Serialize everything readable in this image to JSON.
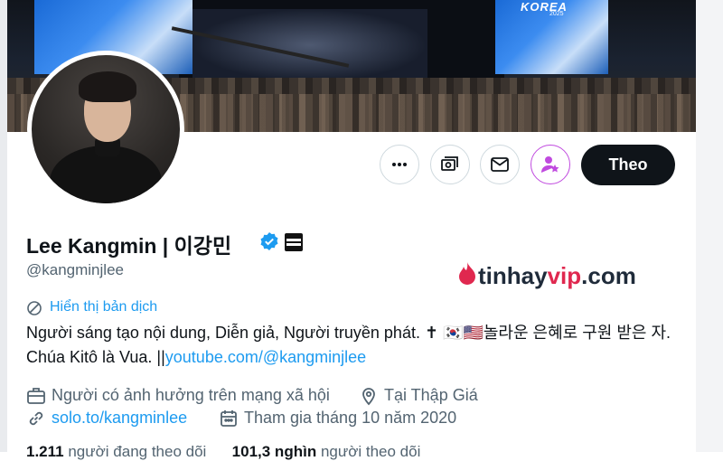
{
  "banner": {
    "event_logo": "KOREA",
    "event_year": "2025"
  },
  "actions": {
    "more": "more-icon",
    "tip": "money-icon",
    "message": "mail-icon",
    "subscribe": "subscribe-star-icon",
    "follow_label": "Theo"
  },
  "profile": {
    "name": "Lee Kangmin | 이강민",
    "handle": "@kangminjlee",
    "translate_label": "Hiển thị bản dịch",
    "bio_text": "Người sáng tạo nội dung, Diễn giả, Người truyền phát. ✝ 🇰🇷🇺🇸놀라운 은혜로 구원 받은 자. Chúa Kitô là Vua. ||",
    "bio_link": "youtube.com/@kangminjlee",
    "category": "Người có ảnh hưởng trên mạng xã hội",
    "location": "Tại Thập Giá",
    "website": "solo.to/kangminlee",
    "joined": "Tham gia tháng 10 năm 2020",
    "following_count": "1.211",
    "following_label": "người đang theo dõi",
    "followers_count": "101,3 nghìn",
    "followers_label": "người theo dõi"
  },
  "watermark": {
    "part1": "tinhay",
    "part2": "vip",
    "part3": ".com"
  },
  "colors": {
    "accent": "#1d9bf0",
    "text": "#0f1419",
    "muted": "#536471",
    "subscribe_border": "#c04adf",
    "watermark_red": "#e0284f"
  }
}
